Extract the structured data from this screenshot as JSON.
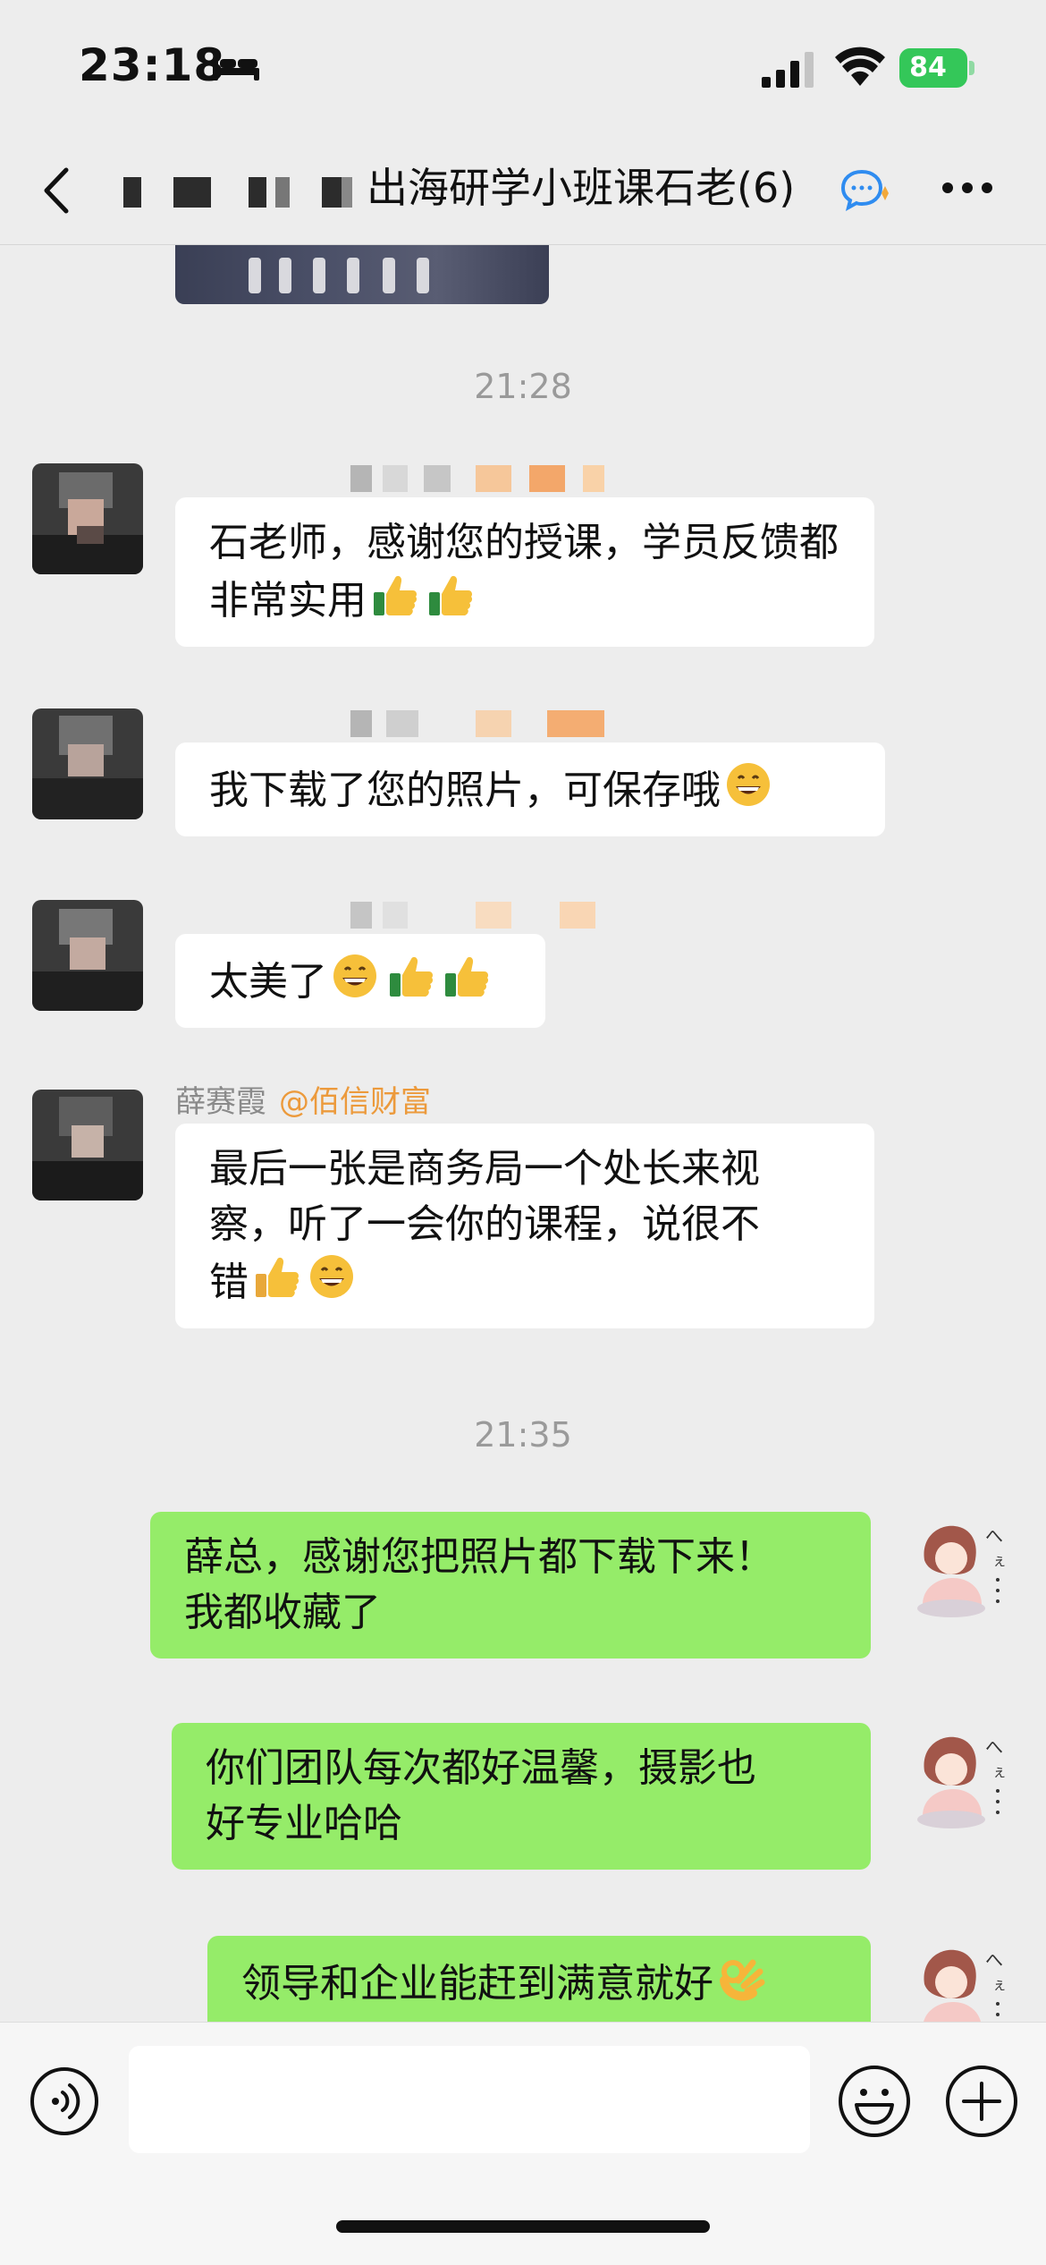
{
  "status_bar": {
    "time": "23:18",
    "battery": "84",
    "icons": [
      "bed-icon",
      "signal-icon",
      "wifi-icon",
      "battery-charging-icon"
    ]
  },
  "nav": {
    "title": "出海研学小班课石老(6)",
    "icons": [
      "back-chevron-icon",
      "group-chat-icon",
      "more-dots-icon"
    ]
  },
  "chat": {
    "timestamps": [
      "21:28",
      "21:35"
    ],
    "messages": [
      {
        "direction": "incoming",
        "text": "石老师，感谢您的授课，学员反馈都非常实用",
        "emoji": [
          "thumbs-up",
          "thumbs-up"
        ]
      },
      {
        "direction": "incoming",
        "text": "我下载了您的照片，可保存哦",
        "emoji": [
          "grinning"
        ]
      },
      {
        "direction": "incoming",
        "text": "太美了",
        "emoji": [
          "grinning",
          "thumbs-up",
          "thumbs-up"
        ]
      },
      {
        "direction": "incoming",
        "sender": "薛赛霞",
        "sender_org": "@佰信财富",
        "text_line1": "最后一张是商务局一个处长来视",
        "text_line2": "察，听了一会你的课程，说很不",
        "text_line3": "错",
        "emoji": [
          "thumbs-up",
          "grinning"
        ]
      },
      {
        "direction": "outgoing",
        "text_line1": "薛总，感谢您把照片都下载下来！",
        "text_line2": "我都收藏了"
      },
      {
        "direction": "outgoing",
        "text_line1": "你们团队每次都好温馨，摄影也",
        "text_line2": "好专业哈哈"
      },
      {
        "direction": "outgoing",
        "text": "领导和企业能赶到满意就好",
        "emoji": [
          "ok-hand"
        ]
      }
    ]
  },
  "input_bar": {
    "placeholder": "",
    "icons": [
      "voice-icon",
      "emoji-icon",
      "plus-icon"
    ]
  },
  "colors": {
    "background": "#ededed",
    "outgoing_bubble": "#95ec69",
    "incoming_bubble": "#ffffff",
    "org_label": "#ec9a3c",
    "battery": "#34c759"
  }
}
